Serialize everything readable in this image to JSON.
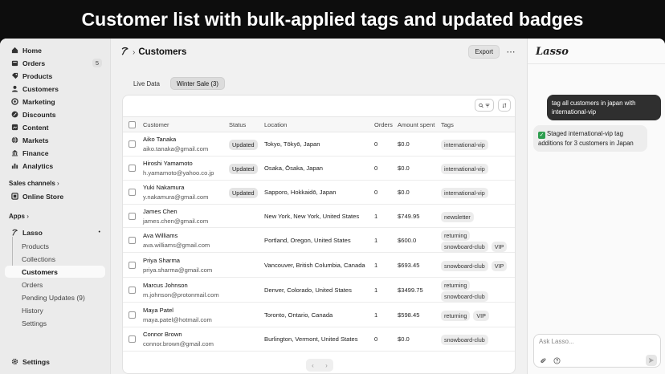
{
  "banner": "Customer list with bulk-applied tags and updated badges",
  "sidebar": {
    "items": [
      {
        "label": "Home",
        "icon": "home-icon"
      },
      {
        "label": "Orders",
        "icon": "orders-icon",
        "badge": "5"
      },
      {
        "label": "Products",
        "icon": "products-icon"
      },
      {
        "label": "Customers",
        "icon": "customers-icon"
      },
      {
        "label": "Marketing",
        "icon": "marketing-icon"
      },
      {
        "label": "Discounts",
        "icon": "discounts-icon"
      },
      {
        "label": "Content",
        "icon": "content-icon"
      },
      {
        "label": "Markets",
        "icon": "markets-icon"
      },
      {
        "label": "Finance",
        "icon": "finance-icon"
      },
      {
        "label": "Analytics",
        "icon": "analytics-icon"
      }
    ],
    "sales_channels": "Sales channels",
    "online_store": "Online Store",
    "apps": "Apps",
    "lasso": "Lasso",
    "lasso_sub": [
      "Products",
      "Collections",
      "Customers",
      "Orders",
      "Pending Updates (9)",
      "History",
      "Settings"
    ],
    "settings": "Settings"
  },
  "header": {
    "title": "Customers",
    "export": "Export"
  },
  "tabs": [
    "Live Data",
    "Winter Sale (3)"
  ],
  "table": {
    "columns": [
      "Customer",
      "Status",
      "Location",
      "Orders",
      "Amount spent",
      "Tags"
    ],
    "rows": [
      {
        "name": "Aiko Tanaka",
        "email": "aiko.tanaka@gmail.com",
        "status": "Updated",
        "location": "Tokyo, Tōkyō, Japan",
        "orders": "0",
        "amount": "$0.0",
        "tags": [
          "international-vip"
        ]
      },
      {
        "name": "Hiroshi Yamamoto",
        "email": "h.yamamoto@yahoo.co.jp",
        "status": "Updated",
        "location": "Osaka, Ōsaka, Japan",
        "orders": "0",
        "amount": "$0.0",
        "tags": [
          "international-vip"
        ]
      },
      {
        "name": "Yuki Nakamura",
        "email": "y.nakamura@gmail.com",
        "status": "Updated",
        "location": "Sapporo, Hokkaidō, Japan",
        "orders": "0",
        "amount": "$0.0",
        "tags": [
          "international-vip"
        ]
      },
      {
        "name": "James Chen",
        "email": "james.chen@gmail.com",
        "status": "",
        "location": "New York, New York, United States",
        "orders": "1",
        "amount": "$749.95",
        "tags": [
          "newsletter"
        ]
      },
      {
        "name": "Ava Williams",
        "email": "ava.williams@gmail.com",
        "status": "",
        "location": "Portland, Oregon, United States",
        "orders": "1",
        "amount": "$600.0",
        "tags": [
          "returning",
          "snowboard-club",
          "VIP"
        ]
      },
      {
        "name": "Priya Sharma",
        "email": "priya.sharma@gmail.com",
        "status": "",
        "location": "Vancouver, British Columbia, Canada",
        "orders": "1",
        "amount": "$693.45",
        "tags": [
          "snowboard-club",
          "VIP"
        ]
      },
      {
        "name": "Marcus Johnson",
        "email": "m.johnson@protonmail.com",
        "status": "",
        "location": "Denver, Colorado, United States",
        "orders": "1",
        "amount": "$3499.75",
        "tags": [
          "returning",
          "snowboard-club"
        ]
      },
      {
        "name": "Maya Patel",
        "email": "maya.patel@hotmail.com",
        "status": "",
        "location": "Toronto, Ontario, Canada",
        "orders": "1",
        "amount": "$598.45",
        "tags": [
          "returning",
          "VIP"
        ]
      },
      {
        "name": "Connor Brown",
        "email": "connor.brown@gmail.com",
        "status": "",
        "location": "Burlington, Vermont, United States",
        "orders": "0",
        "amount": "$0.0",
        "tags": [
          "snowboard-club"
        ]
      }
    ]
  },
  "chat": {
    "user_message": "tag all customers in japan with international-vip",
    "bot_message": "Staged international-vip tag additions for 3 customers in Japan",
    "input_placeholder": "Ask Lasso..."
  },
  "colors": {
    "accent": "#2e9e4f",
    "user_bubble": "#2f2f2f"
  }
}
